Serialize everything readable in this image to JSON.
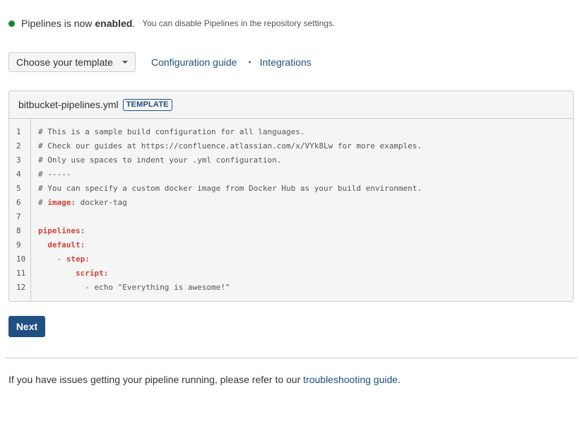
{
  "status": {
    "main": "Pipelines is now",
    "strong": "enabled",
    "period": ".",
    "sub": "You can disable Pipelines in the repository settings.",
    "dot_color": "#14892c"
  },
  "toolbar": {
    "template_select": "Choose your template",
    "config_link": "Configuration guide",
    "separator": "•",
    "integrations_link": "Integrations"
  },
  "editor": {
    "filename": "bitbucket-pipelines.yml",
    "badge": "TEMPLATE",
    "line_numbers": [
      "1",
      "2",
      "3",
      "4",
      "5",
      "6",
      "7",
      "8",
      "9",
      "10",
      "11",
      "12"
    ],
    "lines": [
      {
        "pre": "# This is a sample build configuration for all languages.",
        "key": "",
        "post": ""
      },
      {
        "pre": "# Check our guides at https://confluence.atlassian.com/x/VYk8Lw for more examples.",
        "key": "",
        "post": ""
      },
      {
        "pre": "# Only use spaces to indent your .yml configuration.",
        "key": "",
        "post": ""
      },
      {
        "pre": "# -----",
        "key": "",
        "post": ""
      },
      {
        "pre": "# You can specify a custom docker image from Docker Hub as your build environment.",
        "key": "",
        "post": ""
      },
      {
        "pre": "# ",
        "key": "image:",
        "post": " docker-tag"
      },
      {
        "pre": "",
        "key": "",
        "post": ""
      },
      {
        "pre": "",
        "key": "pipelines:",
        "post": ""
      },
      {
        "pre": "  ",
        "key": "default:",
        "post": ""
      },
      {
        "pre": "    - ",
        "key": "step:",
        "post": ""
      },
      {
        "pre": "        ",
        "key": "script:",
        "post": ""
      },
      {
        "pre": "          - echo \"Everything is awesome!\"",
        "key": "",
        "post": ""
      }
    ]
  },
  "next_button": "Next",
  "footer": {
    "text": "If you have issues getting your pipeline running, please refer to our",
    "link": "troubleshooting guide",
    "period": "."
  }
}
